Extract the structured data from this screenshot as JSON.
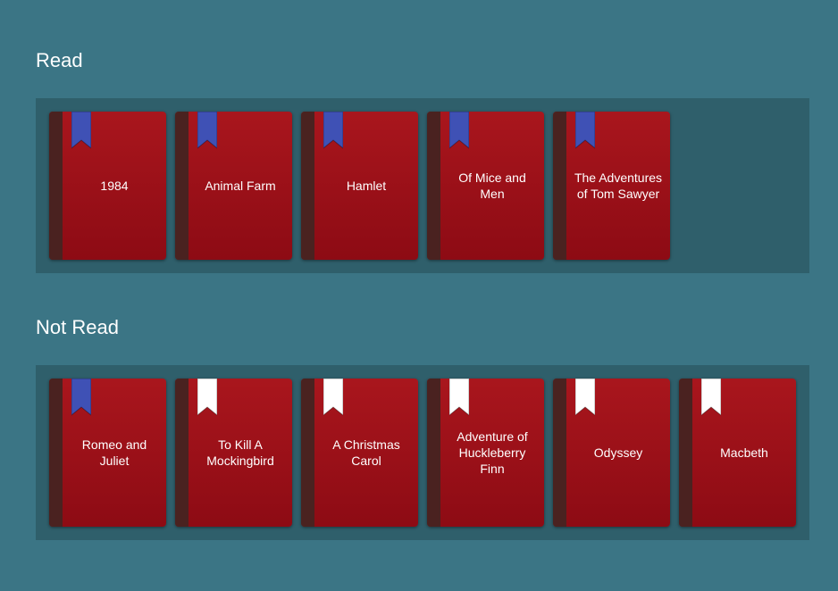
{
  "colors": {
    "background": "#3b7585",
    "shelf": "#2f5f6b",
    "book_cover": "#9b1019",
    "book_spine": "#4a2220",
    "bookmark_read": "#3f51b5",
    "bookmark_unread": "#ffffff"
  },
  "sections": {
    "read": {
      "title": "Read",
      "books": [
        {
          "title": "1984",
          "bookmark": "blue-bookmark-icon"
        },
        {
          "title": "Animal Farm",
          "bookmark": "blue-bookmark-icon"
        },
        {
          "title": "Hamlet",
          "bookmark": "blue-bookmark-icon"
        },
        {
          "title": "Of Mice and Men",
          "bookmark": "blue-bookmark-icon"
        },
        {
          "title": "The Adventures of Tom Sawyer",
          "bookmark": "blue-bookmark-icon"
        }
      ]
    },
    "not_read": {
      "title": "Not Read",
      "books": [
        {
          "title": "Romeo and Juliet",
          "bookmark": "blue-bookmark-icon"
        },
        {
          "title": "To Kill A Mockingbird",
          "bookmark": "white-bookmark-icon"
        },
        {
          "title": "A Christmas Carol",
          "bookmark": "white-bookmark-icon"
        },
        {
          "title": "Adventure of Huckleberry Finn",
          "bookmark": "white-bookmark-icon"
        },
        {
          "title": "Odyssey",
          "bookmark": "white-bookmark-icon"
        },
        {
          "title": "Macbeth",
          "bookmark": "white-bookmark-icon"
        }
      ]
    }
  }
}
